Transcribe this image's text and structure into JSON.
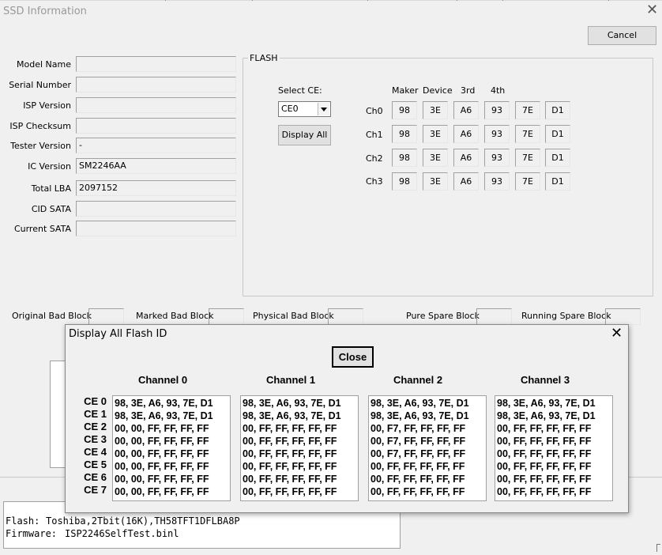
{
  "main_window": {
    "title": "SSD Information",
    "cancel_label": "Cancel",
    "fields": [
      {
        "label": "Model Name",
        "value": ""
      },
      {
        "label": "Serial Number",
        "value": ""
      },
      {
        "label": "ISP Version",
        "value": ""
      },
      {
        "label": "ISP Checksum",
        "value": ""
      },
      {
        "label": "Tester Version",
        "value": "-"
      },
      {
        "label": "IC Version",
        "value": "SM2246AA"
      },
      {
        "label": "Total LBA",
        "value": "2097152"
      },
      {
        "label": "CID SATA",
        "value": ""
      },
      {
        "label": "Current SATA",
        "value": ""
      }
    ],
    "flash": {
      "legend": "FLASH",
      "select_label": "Select CE:",
      "select_value": "CE0",
      "display_all_label": "Display All",
      "columns": [
        "Maker",
        "Device",
        "3rd",
        "4th"
      ],
      "rows": [
        {
          "label": "Ch0",
          "values": [
            "98",
            "3E",
            "A6",
            "93",
            "7E",
            "D1"
          ]
        },
        {
          "label": "Ch1",
          "values": [
            "98",
            "3E",
            "A6",
            "93",
            "7E",
            "D1"
          ]
        },
        {
          "label": "Ch2",
          "values": [
            "98",
            "3E",
            "A6",
            "93",
            "7E",
            "D1"
          ]
        },
        {
          "label": "Ch3",
          "values": [
            "98",
            "3E",
            "A6",
            "93",
            "7E",
            "D1"
          ]
        }
      ]
    },
    "blocks": {
      "original": "Original Bad Block",
      "marked": "Marked Bad Block",
      "physical": "Physical Bad Block",
      "pure_spare": "Pure Spare Block",
      "running_spare": "Running Spare Block"
    },
    "info": {
      "flash_label": "Flash:",
      "flash_value": "Toshiba,2Tbit(16K),TH58TFT1DFLBA8P",
      "firmware_label": "Firmware:",
      "firmware_value": "ISP2246SelfTest.binl"
    }
  },
  "dialog": {
    "title": "Display All Flash ID",
    "close_label": "Close",
    "ce_labels": [
      "CE 0",
      "CE 1",
      "CE 2",
      "CE 3",
      "CE 4",
      "CE 5",
      "CE 6",
      "CE 7"
    ],
    "channels": [
      {
        "name": "Channel 0",
        "lines": [
          "98, 3E, A6, 93, 7E, D1",
          "98, 3E, A6, 93, 7E, D1",
          "00, 00, FF, FF, FF, FF",
          "00, 00, FF, FF, FF, FF",
          "00, 00, FF, FF, FF, FF",
          "00, 00, FF, FF, FF, FF",
          "00, 00, FF, FF, FF, FF",
          "00, 00, FF, FF, FF, FF"
        ]
      },
      {
        "name": "Channel 1",
        "lines": [
          "98, 3E, A6, 93, 7E, D1",
          "98, 3E, A6, 93, 7E, D1",
          "00, FF, FF, FF, FF, FF",
          "00, FF, FF, FF, FF, FF",
          "00, FF, FF, FF, FF, FF",
          "00, FF, FF, FF, FF, FF",
          "00, FF, FF, FF, FF, FF",
          "00, FF, FF, FF, FF, FF"
        ]
      },
      {
        "name": "Channel 2",
        "lines": [
          "98, 3E, A6, 93, 7E, D1",
          "98, 3E, A6, 93, 7E, D1",
          "00, F7, FF, FF, FF, FF",
          "00, F7, FF, FF, FF, FF",
          "00, F7, FF, FF, FF, FF",
          "00, FF, FF, FF, FF, FF",
          "00, FF, FF, FF, FF, FF",
          "00, FF, FF, FF, FF, FF"
        ]
      },
      {
        "name": "Channel 3",
        "lines": [
          "98, 3E, A6, 93, 7E, D1",
          "98, 3E, A6, 93, 7E, D1",
          "00, FF, FF, FF, FF, FF",
          "00, FF, FF, FF, FF, FF",
          "00, FF, FF, FF, FF, FF",
          "00, FF, FF, FF, FF, FF",
          "00, FF, FF, FF, FF, FF",
          "00, FF, FF, FF, FF, FF"
        ]
      }
    ]
  }
}
